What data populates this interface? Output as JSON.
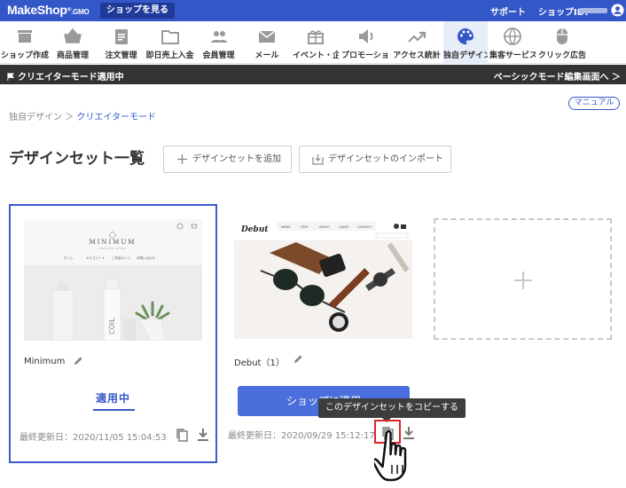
{
  "topbar": {
    "logo": "MakeShop",
    "logo_suffix": "GMO",
    "view_shop": "ショップを見る",
    "support": "サポート",
    "shop_id_label": "ショップID："
  },
  "nav": [
    {
      "label": "ショップ作成",
      "icon": "storefront-icon"
    },
    {
      "label": "商品管理",
      "icon": "basket-icon"
    },
    {
      "label": "注文管理",
      "icon": "clipboard-icon"
    },
    {
      "label": "即日売上入金",
      "icon": "folder-icon"
    },
    {
      "label": "会員管理",
      "icon": "people-icon"
    },
    {
      "label": "メール",
      "icon": "mail-icon"
    },
    {
      "label": "イベント・企画",
      "icon": "gift-icon"
    },
    {
      "label": "プロモーション",
      "icon": "speaker-icon"
    },
    {
      "label": "アクセス統計",
      "icon": "trending-icon"
    },
    {
      "label": "独自デザイン",
      "icon": "palette-icon",
      "active": true
    },
    {
      "label": "集客サービス",
      "icon": "globe-icon"
    },
    {
      "label": "クリック広告",
      "icon": "mouse-icon"
    }
  ],
  "mode_bar": {
    "left": "クリエイターモード適用中",
    "right": "ベーシックモード編集画面へ ＞"
  },
  "manual": "マニュアル",
  "breadcrumb": {
    "parent": "独自デザイン",
    "separator": "＞",
    "current": "クリエイターモード"
  },
  "page_title": "デザインセット一覧",
  "buttons": {
    "add_set": "デザインセットを追加",
    "import_set": "デザインセットのインポート"
  },
  "cards": [
    {
      "name": "Minimum",
      "status": "適用中",
      "updated": "最終更新日：2020/11/05 15:04:53",
      "thumb": {
        "brand": "MINIMUM",
        "brand_sub": "ONLINE SHOP",
        "menu": [
          "ホーム",
          "カテゴリー ▾",
          "ご利用ガイド",
          "お問い合わせ"
        ],
        "bottle_text": "COIL"
      }
    },
    {
      "name": "Debut（1）",
      "action": "ショップに適用",
      "updated": "最終更新日：2020/09/29 15:12:17",
      "thumb": {
        "brand": "Debut",
        "menu": [
          "NEWS",
          "ITEM",
          "ABOUT",
          "GUIDE",
          "CONTACT"
        ]
      }
    }
  ],
  "tooltip": "このデザインセットをコピーする",
  "colors": {
    "primary": "#3457c8",
    "topbar": "#3457c8",
    "mode_bar": "#333333",
    "highlight": "#d9242b"
  }
}
